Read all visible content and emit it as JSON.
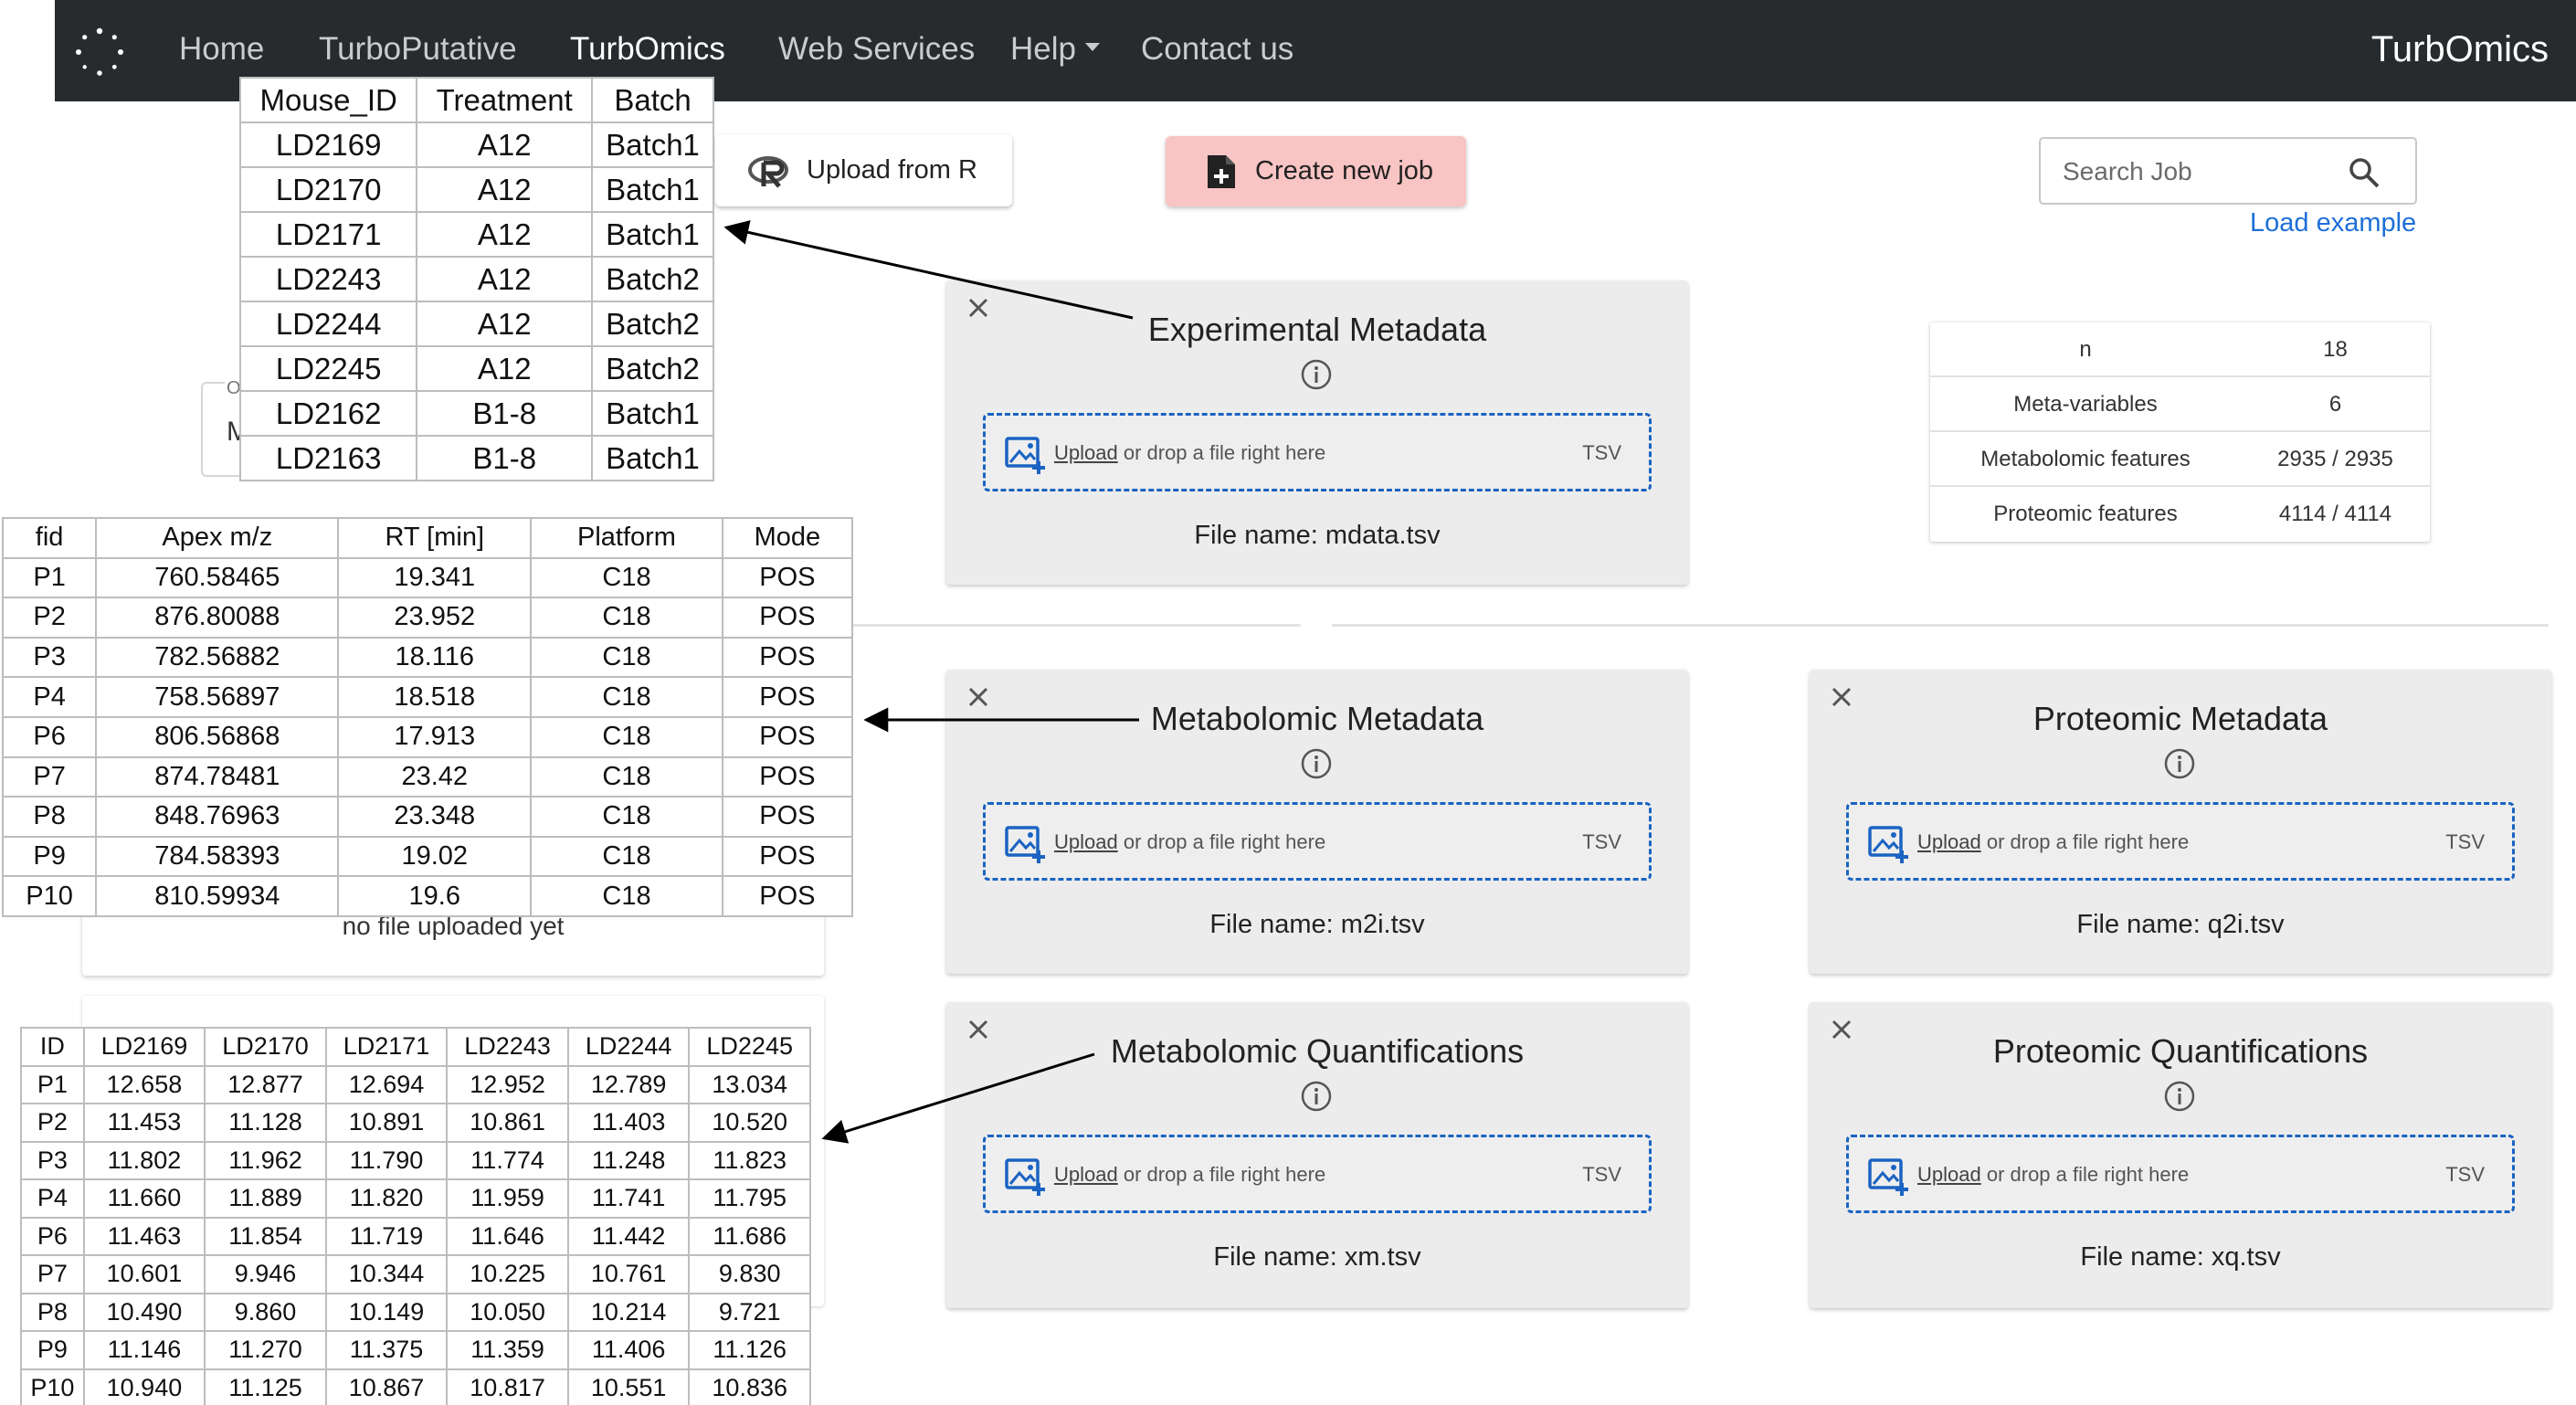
{
  "navbar": {
    "logo_icon": "spinner-logo-icon",
    "items": [
      "Home",
      "TurboPutative",
      "TurbOmics",
      "Web Services",
      "Help",
      "Contact us"
    ],
    "active_item": "TurbOmics",
    "brand": "TurbOmics"
  },
  "toolbar": {
    "upload_r_label": "Upload from R",
    "upload_r_icon": "r-logo-icon",
    "create_job_label": "Create new job",
    "create_job_icon": "file-plus-icon",
    "search_placeholder": "Search Job",
    "search_icon": "search-icon",
    "load_example": "Load example"
  },
  "stats": [
    {
      "label": "n",
      "value": "18"
    },
    {
      "label": "Meta-variables",
      "value": "6"
    },
    {
      "label": "Metabolomic features",
      "value": "2935 / 2935"
    },
    {
      "label": "Proteomic features",
      "value": "4114 / 4114"
    }
  ],
  "panels": [
    {
      "title": "Experimental Metadata",
      "upload_link": "Upload",
      "upload_text": " or drop a file right here",
      "ext": "TSV",
      "file_name": "File name: mdata.tsv"
    },
    {
      "title": "Metabolomic Metadata",
      "upload_link": "Upload",
      "upload_text": " or drop a file right here",
      "ext": "TSV",
      "file_name": "File name: m2i.tsv"
    },
    {
      "title": "Proteomic Metadata",
      "upload_link": "Upload",
      "upload_text": " or drop a file right here",
      "ext": "TSV",
      "file_name": "File name: q2i.tsv"
    },
    {
      "title": "Metabolomic Quantifications",
      "upload_link": "Upload",
      "upload_text": " or drop a file right here",
      "ext": "TSV",
      "file_name": "File name: xm.tsv"
    },
    {
      "title": "Proteomic Quantifications",
      "upload_link": "Upload",
      "upload_text": " or drop a file right here",
      "ext": "TSV",
      "file_name": "File name: xq.tsv"
    }
  ],
  "background": {
    "partial_label_1": "O",
    "partial_label_2": "M",
    "no_file_msg": "no file uploaded yet"
  },
  "tables": {
    "experimental": {
      "headers": [
        "Mouse_ID",
        "Treatment",
        "Batch"
      ],
      "rows": [
        [
          "LD2169",
          "A12",
          "Batch1"
        ],
        [
          "LD2170",
          "A12",
          "Batch1"
        ],
        [
          "LD2171",
          "A12",
          "Batch1"
        ],
        [
          "LD2243",
          "A12",
          "Batch2"
        ],
        [
          "LD2244",
          "A12",
          "Batch2"
        ],
        [
          "LD2245",
          "A12",
          "Batch2"
        ],
        [
          "LD2162",
          "B1-8",
          "Batch1"
        ],
        [
          "LD2163",
          "B1-8",
          "Batch1"
        ]
      ]
    },
    "metabolomic_metadata": {
      "headers": [
        "fid",
        "Apex m/z",
        "RT [min]",
        "Platform",
        "Mode"
      ],
      "rows": [
        [
          "P1",
          "760.58465",
          "19.341",
          "C18",
          "POS"
        ],
        [
          "P2",
          "876.80088",
          "23.952",
          "C18",
          "POS"
        ],
        [
          "P3",
          "782.56882",
          "18.116",
          "C18",
          "POS"
        ],
        [
          "P4",
          "758.56897",
          "18.518",
          "C18",
          "POS"
        ],
        [
          "P6",
          "806.56868",
          "17.913",
          "C18",
          "POS"
        ],
        [
          "P7",
          "874.78481",
          "23.42",
          "C18",
          "POS"
        ],
        [
          "P8",
          "848.76963",
          "23.348",
          "C18",
          "POS"
        ],
        [
          "P9",
          "784.58393",
          "19.02",
          "C18",
          "POS"
        ],
        [
          "P10",
          "810.59934",
          "19.6",
          "C18",
          "POS"
        ]
      ]
    },
    "metabolomic_quant": {
      "headers": [
        "ID",
        "LD2169",
        "LD2170",
        "LD2171",
        "LD2243",
        "LD2244",
        "LD2245"
      ],
      "rows": [
        [
          "P1",
          "12.658",
          "12.877",
          "12.694",
          "12.952",
          "12.789",
          "13.034"
        ],
        [
          "P2",
          "11.453",
          "11.128",
          "10.891",
          "10.861",
          "11.403",
          "10.520"
        ],
        [
          "P3",
          "11.802",
          "11.962",
          "11.790",
          "11.774",
          "11.248",
          "11.823"
        ],
        [
          "P4",
          "11.660",
          "11.889",
          "11.820",
          "11.959",
          "11.741",
          "11.795"
        ],
        [
          "P6",
          "11.463",
          "11.854",
          "11.719",
          "11.646",
          "11.442",
          "11.686"
        ],
        [
          "P7",
          "10.601",
          "9.946",
          "10.344",
          "10.225",
          "10.761",
          "9.830"
        ],
        [
          "P8",
          "10.490",
          "9.860",
          "10.149",
          "10.050",
          "10.214",
          "9.721"
        ],
        [
          "P9",
          "11.146",
          "11.270",
          "11.375",
          "11.359",
          "11.406",
          "11.126"
        ],
        [
          "P10",
          "10.940",
          "11.125",
          "10.867",
          "10.817",
          "10.551",
          "10.836"
        ]
      ]
    }
  },
  "colors": {
    "navbar_bg": "#282b2d",
    "accent_blue": "#1a63c2",
    "create_job_bg": "#f9c4c4",
    "panel_bg": "#ececec"
  }
}
